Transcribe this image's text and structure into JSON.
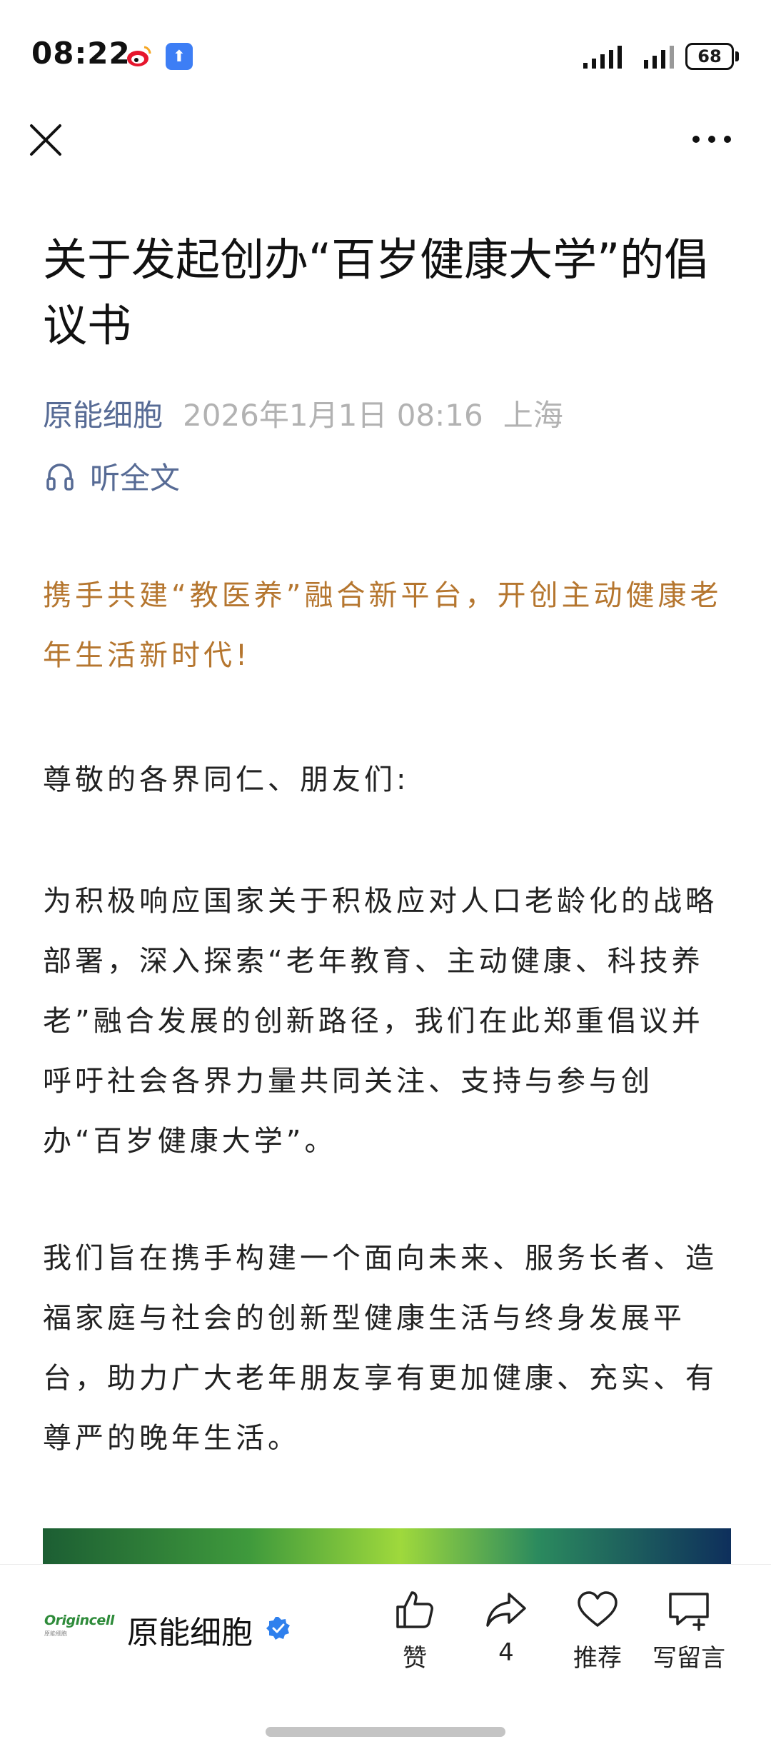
{
  "status_bar": {
    "time": "08:22",
    "battery": "68",
    "icons": [
      "weibo-icon",
      "upload-icon",
      "signal-icon",
      "signal-icon",
      "battery-icon"
    ]
  },
  "nav": {
    "close_icon": "close-icon",
    "more_icon": "more-icon"
  },
  "article": {
    "title": "关于发起创办“百岁健康大学”的倡议书",
    "author": "原能细胞",
    "date": "2026年1月1日 08:16",
    "location": "上海",
    "listen_label": "听全文",
    "highlight": "携手共建“教医养”融合新平台，开创主动健康老年生活新时代!",
    "greeting": "尊敬的各界同仁、朋友们:",
    "paragraphs": [
      "为积极响应国家关于积极应对人口老龄化的战略部署，深入探索“老年教育、主动健康、科技养老”融合发展的创新路径，我们在此郑重倡议并呼吁社会各界力量共同关注、支持与参与创办“百岁健康大学”。",
      "我们旨在携手构建一个面向未来、服务长者、造福家庭与社会的创新型健康生活与终身发展平台，助力广大老年朋友享有更加健康、充实、有尊严的晚年生活。"
    ],
    "accent_color": "#b5762f",
    "link_color": "#576b95"
  },
  "bottom_bar": {
    "logo_text": "Origincell",
    "logo_sub": "原能细胞",
    "account_name": "原能细胞",
    "actions": [
      {
        "label": "赞",
        "icon": "thumbs-up-icon"
      },
      {
        "label": "4",
        "icon": "share-icon"
      },
      {
        "label": "推荐",
        "icon": "heart-icon"
      },
      {
        "label": "写留言",
        "icon": "comment-icon"
      }
    ]
  }
}
